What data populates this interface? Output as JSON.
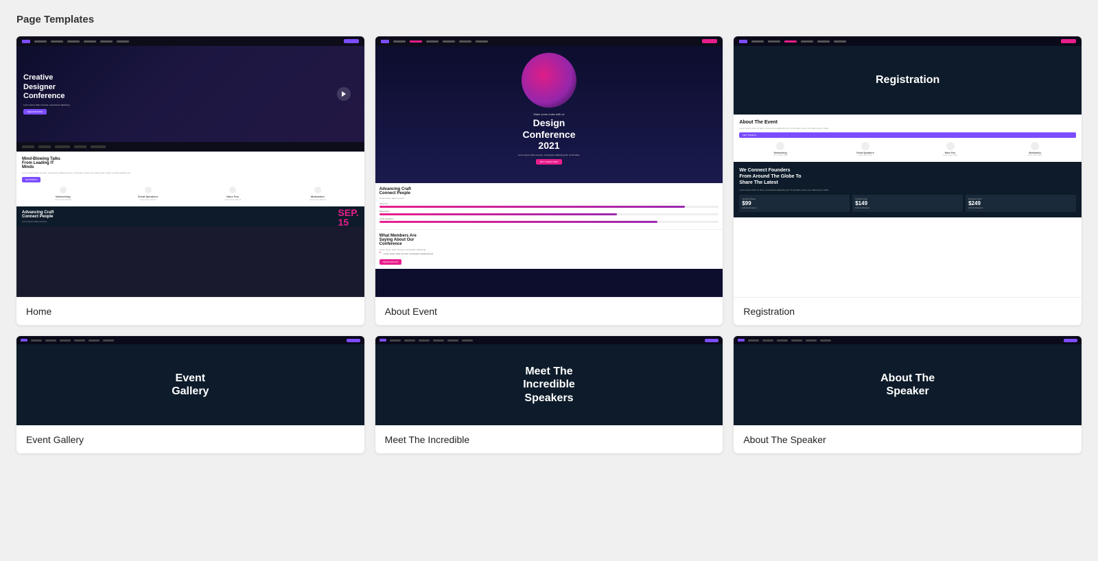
{
  "page": {
    "title": "Page Templates"
  },
  "templates": [
    {
      "id": "home",
      "label": "Home",
      "selected": true,
      "row": 1
    },
    {
      "id": "about-event",
      "label": "About Event",
      "selected": false,
      "row": 1
    },
    {
      "id": "registration",
      "label": "Registration",
      "selected": false,
      "row": 1
    },
    {
      "id": "event-gallery",
      "label": "Event Gallery",
      "selected": false,
      "row": 2,
      "heroText": "Event\nGallery"
    },
    {
      "id": "meet-speaker",
      "label": "Meet The Incredible",
      "selected": false,
      "row": 2,
      "heroText": "Meet The\nIncredible\nSpeakers"
    },
    {
      "id": "about-speaker",
      "label": "About The Speaker",
      "selected": false,
      "row": 2,
      "heroText": "About The\nSpeaker"
    }
  ],
  "home": {
    "nav_items": [
      "Home",
      "About Event",
      "Registration",
      "Pages",
      "Blog",
      "Contact"
    ],
    "hero_title": "Creative\nDesigner\nConference",
    "section_title": "Mind-Blowing Talks\nFrom Leading IT\nMinds",
    "footer_title": "Advancing Craft\nConnect People",
    "footer_date": "SEP.\n15"
  },
  "about_event": {
    "sub_label": "Make some noise with us",
    "hero_title": "Design\nConference\n2021",
    "hero_text": "Lorem ipsum dolor sit amet",
    "section_left": "Advancing Craft\nConnect People",
    "section_right": "What Members Are\nSaying About Our\nConference",
    "bars": [
      {
        "label": "Have Fun",
        "width": "90%"
      },
      {
        "label": "Networking",
        "width": "70%"
      },
      {
        "label": "Great Speakers",
        "width": "80%"
      }
    ]
  },
  "registration": {
    "hero_title": "Registration",
    "about_title": "About The Event",
    "dark_title": "We Connect Founders\nFrom Around The Globe To\nShare The Latest",
    "prices": [
      {
        "type": "Standard Pass",
        "value": "$99",
        "label": "Full Conference"
      },
      {
        "type": "Flexible Pass",
        "value": "$149",
        "label": "Full Conference"
      },
      {
        "type": "Business Pass",
        "value": "$249",
        "label": "Full Conference"
      }
    ]
  }
}
